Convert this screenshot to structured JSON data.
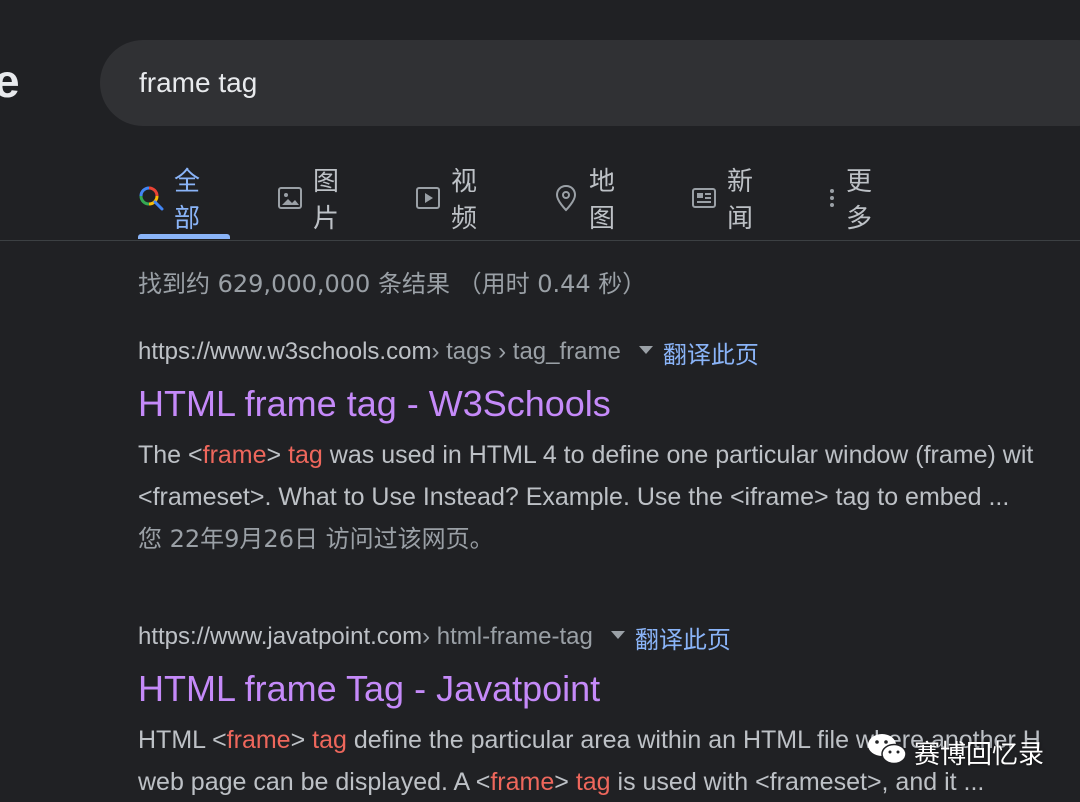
{
  "search": {
    "query": "frame tag"
  },
  "logo_fragment": "e",
  "tabs": [
    {
      "label": "全部",
      "icon": "search-icon",
      "active": true
    },
    {
      "label": "图片",
      "icon": "image-icon"
    },
    {
      "label": "视频",
      "icon": "video-icon"
    },
    {
      "label": "地图",
      "icon": "map-pin-icon"
    },
    {
      "label": "新闻",
      "icon": "news-icon"
    },
    {
      "label": "更多",
      "icon": "more-vert-icon"
    }
  ],
  "result_stats": "找到约 629,000,000 条结果 （用时 0.44 秒）",
  "results": [
    {
      "domain": "https://www.w3schools.com",
      "crumbs": " › tags › tag_frame",
      "translate": "翻译此页",
      "title": "HTML frame tag - W3Schools",
      "line1": {
        "a": "The <",
        "b": "frame",
        "c": "> ",
        "d": "tag",
        "e": " was used in HTML 4 to define one particular window (frame) wit"
      },
      "line2": "<frameset>. What to Use Instead? Example. Use the <iframe> tag to embed ...",
      "visited": "您 22年9月26日 访问过该网页。"
    },
    {
      "domain": "https://www.javatpoint.com",
      "crumbs": " › html-frame-tag",
      "translate": "翻译此页",
      "title": "HTML frame Tag - Javatpoint",
      "line1": {
        "a": "HTML <",
        "b": "frame",
        "c": "> ",
        "d": "tag",
        "e": " define the particular area within an HTML file where another H"
      },
      "line2": {
        "a": "web page can be displayed. A <",
        "b": "frame",
        "c": "> ",
        "d": "tag",
        "e": " is used with <frameset>, and it ..."
      }
    }
  ],
  "watermark": {
    "text": "赛博回忆录",
    "icon": "wechat-icon"
  },
  "colors": {
    "background": "#202124",
    "search_box": "#303134",
    "active_tab": "#8ab4f8",
    "visited_link": "#c58af9",
    "highlight": "#ee675c",
    "secondary_text": "#9aa0a6"
  }
}
